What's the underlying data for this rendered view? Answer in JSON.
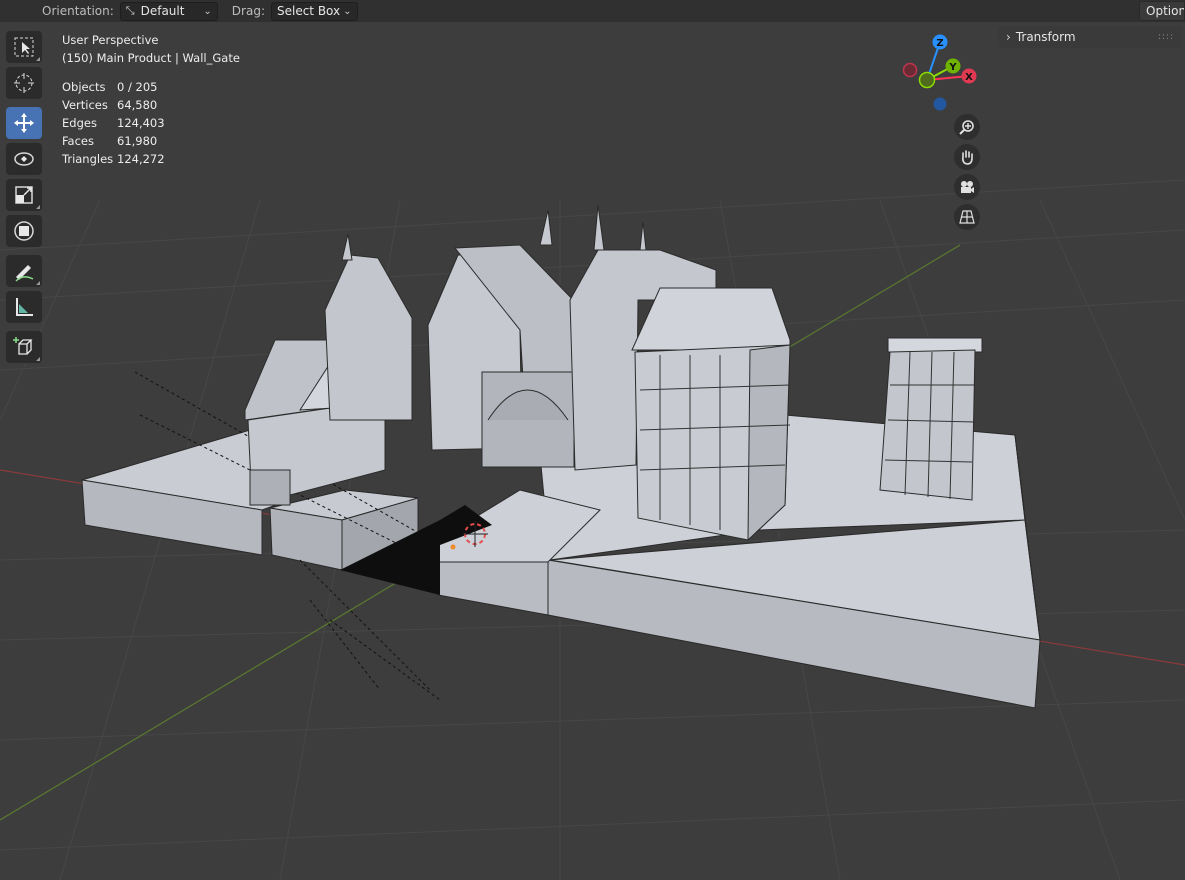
{
  "header": {
    "orientation_label": "Orientation:",
    "orientation_value": "Default",
    "drag_label": "Drag:",
    "drag_value": "Select Box",
    "options_label": "Options"
  },
  "info": {
    "view": "User Perspective",
    "context": "(150) Main Product | Wall_Gate",
    "stats": [
      {
        "label": "Objects",
        "value": "0 / 205"
      },
      {
        "label": "Vertices",
        "value": "64,580"
      },
      {
        "label": "Edges",
        "value": "124,403"
      },
      {
        "label": "Faces",
        "value": "61,980"
      },
      {
        "label": "Triangles",
        "value": "124,272"
      }
    ]
  },
  "gizmo": {
    "z": "Z",
    "y": "Y",
    "x": "X"
  },
  "sidebar": {
    "transform_label": "Transform"
  },
  "toolbar": [
    {
      "icon": "select-box-icon"
    },
    {
      "icon": "cursor-icon"
    },
    {
      "icon": "move-icon",
      "active": true
    },
    {
      "icon": "rotate-icon"
    },
    {
      "icon": "scale-icon"
    },
    {
      "icon": "transform-icon"
    },
    {
      "icon": "annotate-icon"
    },
    {
      "icon": "measure-icon"
    },
    {
      "icon": "add-cube-icon"
    }
  ],
  "nav": [
    "zoom-icon",
    "pan-hand-icon",
    "camera-icon",
    "ortho-grid-icon"
  ],
  "colors": {
    "viewport_bg": "#3d3d3d",
    "header_bg": "#303030",
    "active_tool": "#4772b3",
    "axis_x": "#ff3352",
    "axis_y": "#8bdc00",
    "axis_z": "#2890ff"
  }
}
